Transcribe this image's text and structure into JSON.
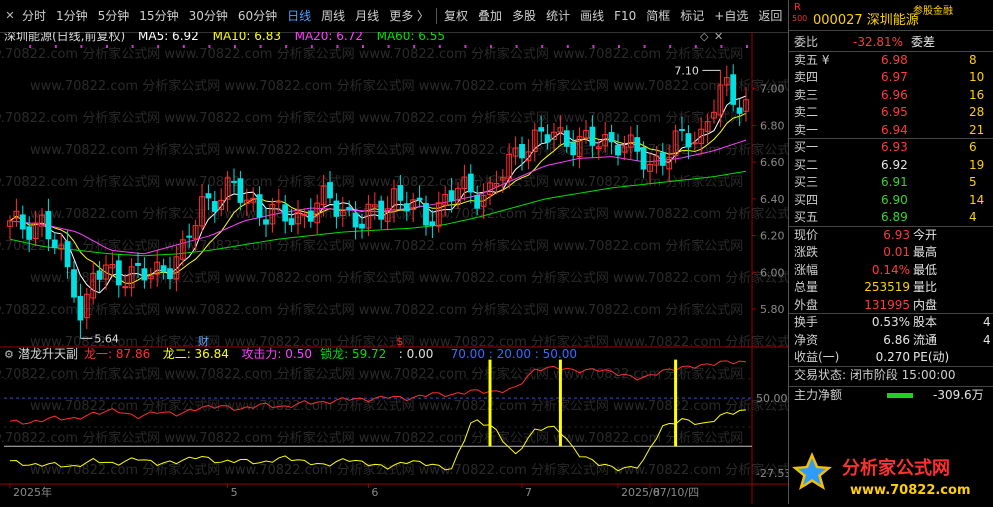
{
  "toolbar": {
    "items": [
      {
        "label": "分时"
      },
      {
        "label": "1分钟"
      },
      {
        "label": "5分钟"
      },
      {
        "label": "15分钟"
      },
      {
        "label": "30分钟"
      },
      {
        "label": "60分钟"
      },
      {
        "label": "日线"
      },
      {
        "label": "周线"
      },
      {
        "label": "月线"
      },
      {
        "label": "更多 〉"
      },
      {
        "label": "复权"
      },
      {
        "label": "叠加"
      },
      {
        "label": "多股"
      },
      {
        "label": "统计"
      },
      {
        "label": "画线"
      },
      {
        "label": "F10"
      },
      {
        "label": "简框"
      },
      {
        "label": "标记"
      },
      {
        "label": "+自选"
      },
      {
        "label": "返回"
      }
    ],
    "active": "日线"
  },
  "chart_data": [
    {
      "type": "candlestick",
      "title": "深圳能源(日线,前复权)",
      "ma_labels": [
        {
          "name": "MA5",
          "value": "MA5: 6.92",
          "color": "#ffffff"
        },
        {
          "name": "MA10",
          "value": "MA10: 6.83",
          "color": "#ffff00"
        },
        {
          "name": "MA20",
          "value": "MA20: 6.72",
          "color": "#ff40ff"
        },
        {
          "name": "MA60",
          "value": "MA60: 6.55",
          "color": "#00e000"
        }
      ],
      "y_ticks": [
        "7.00",
        "6.80",
        "6.60",
        "6.40",
        "6.20",
        "6.00",
        "5.80"
      ],
      "ylim": [
        5.62,
        7.2
      ],
      "x_ticks": [
        "2025年",
        "5",
        "6",
        "7",
        "2025/07/10/四",
        "8"
      ],
      "x_tick_days": [
        0,
        34,
        56,
        80,
        95,
        100
      ],
      "high_marker": "7.10",
      "low_marker": "5.64",
      "event_markers": [
        {
          "text": "财",
          "day": 30
        },
        {
          "text": "$",
          "day": 61
        }
      ],
      "days": 116,
      "ohlc_sampled": [
        {
          "day": 0,
          "close": 6.25
        },
        {
          "day": 5,
          "close": 6.27
        },
        {
          "day": 10,
          "close": 5.95
        },
        {
          "day": 15,
          "close": 6.0
        },
        {
          "day": 22,
          "close": 5.98
        },
        {
          "day": 27,
          "close": 6.1
        },
        {
          "day": 30,
          "close": 6.38
        },
        {
          "day": 35,
          "close": 6.45
        },
        {
          "day": 40,
          "close": 6.32
        },
        {
          "day": 45,
          "close": 6.3
        },
        {
          "day": 50,
          "close": 6.4
        },
        {
          "day": 55,
          "close": 6.26
        },
        {
          "day": 60,
          "close": 6.42
        },
        {
          "day": 65,
          "close": 6.3
        },
        {
          "day": 70,
          "close": 6.45
        },
        {
          "day": 75,
          "close": 6.43
        },
        {
          "day": 80,
          "close": 6.7
        },
        {
          "day": 85,
          "close": 6.75
        },
        {
          "day": 90,
          "close": 6.7
        },
        {
          "day": 95,
          "close": 6.72
        },
        {
          "day": 100,
          "close": 6.58
        },
        {
          "day": 104,
          "close": 6.7
        },
        {
          "day": 108,
          "close": 6.75
        },
        {
          "day": 111,
          "close": 7.02
        },
        {
          "day": 113,
          "close": 6.93
        },
        {
          "day": 115,
          "close": 6.93
        }
      ],
      "ma_sampled": {
        "MA20": [
          6.28,
          6.26,
          6.22,
          6.12,
          6.1,
          6.15,
          6.2,
          6.28,
          6.32,
          6.35,
          6.34,
          6.33,
          6.35,
          6.38,
          6.42,
          6.5,
          6.58,
          6.62,
          6.63,
          6.6,
          6.62,
          6.66,
          6.72
        ],
        "MA60": [
          6.18,
          6.14,
          6.12,
          6.1,
          6.09,
          6.1,
          6.12,
          6.15,
          6.18,
          6.2,
          6.22,
          6.23,
          6.24,
          6.26,
          6.3,
          6.35,
          6.4,
          6.43,
          6.46,
          6.48,
          6.5,
          6.52,
          6.55
        ]
      }
    },
    {
      "type": "line",
      "title": "潜龙升天副",
      "series": [
        {
          "name": "龙一",
          "value": "87.86",
          "color": "#ff3030"
        },
        {
          "name": "龙二",
          "value": "36.84",
          "color": "#ffff00"
        },
        {
          "name": "攻击力",
          "value": "0.50",
          "color": "#ff40ff"
        },
        {
          "name": "锁龙",
          "value": "59.72",
          "color": "#00e000"
        },
        {
          "name": "",
          "value": "0.00",
          "color": "#e0e0e0"
        }
      ],
      "levels_text": "70.00 : 20.00 : 50.00",
      "y_ticks": [
        "50.00",
        "-27.53"
      ],
      "ylim": [
        -35,
        100
      ],
      "signal_days": [
        75,
        86,
        104
      ],
      "long_one_sampled": [
        26,
        24,
        30,
        28,
        34,
        38,
        30,
        36,
        33,
        40,
        42,
        38,
        44,
        40,
        46,
        45,
        50,
        48,
        52,
        49,
        55,
        53,
        58,
        56,
        60,
        80,
        82,
        78,
        80,
        75,
        70,
        78,
        82,
        84,
        88,
        87
      ],
      "long_two_sampled": [
        -15,
        -20,
        -18,
        -22,
        -14,
        -19,
        -12,
        -18,
        -16,
        -10,
        -17,
        -14,
        -18,
        -11,
        -16,
        -20,
        -13,
        -18,
        -22,
        -15,
        -19,
        -24,
        28,
        20,
        -10,
        18,
        20,
        -8,
        -18,
        -24,
        -20,
        20,
        28,
        22,
        34,
        37
      ]
    }
  ],
  "quote_panel": {
    "code_name": "000027 深圳能源",
    "top_tag": "参股金融",
    "r_tag": "R",
    "r_sub": "500",
    "weibi": {
      "label": "委比",
      "value": "-32.81%",
      "label2": "委差"
    },
    "sells": [
      {
        "label": "卖五 ¥",
        "price": "6.98",
        "vol": "8"
      },
      {
        "label": "卖四",
        "price": "6.97",
        "vol": "10"
      },
      {
        "label": "卖三",
        "price": "6.96",
        "vol": "16"
      },
      {
        "label": "卖二",
        "price": "6.95",
        "vol": "28"
      },
      {
        "label": "卖一",
        "price": "6.94",
        "vol": "21"
      }
    ],
    "buys": [
      {
        "label": "买一",
        "price": "6.93",
        "vol": "6"
      },
      {
        "label": "买二",
        "price": "6.92",
        "vol": "19"
      },
      {
        "label": "买三",
        "price": "6.91",
        "vol": "5"
      },
      {
        "label": "买四",
        "price": "6.90",
        "vol": "14"
      },
      {
        "label": "买五",
        "price": "6.89",
        "vol": "4"
      }
    ],
    "stats": [
      {
        "l1": "现价",
        "v1": "6.93",
        "c1": "red",
        "l2": "今开"
      },
      {
        "l1": "涨跌",
        "v1": "0.01",
        "c1": "red",
        "l2": "最高"
      },
      {
        "l1": "涨幅",
        "v1": "0.14%",
        "c1": "red",
        "l2": "最低"
      },
      {
        "l1": "总量",
        "v1": "253519",
        "c1": "yellow",
        "l2": "量比"
      },
      {
        "l1": "外盘",
        "v1": "131995",
        "c1": "red",
        "l2": "内盘"
      }
    ],
    "stats2": [
      {
        "l1": "换手",
        "v1": "0.53%",
        "l2": "股本",
        "v2": "4"
      },
      {
        "l1": "净资",
        "v1": "6.86",
        "l2": "流通",
        "v2": "4"
      },
      {
        "l1": "收益(一)",
        "v1": "0.270",
        "l2": "PE(动)",
        "v2": ""
      }
    ],
    "trade_status": "交易状态: 闭市阶段 15:00:00",
    "main_net_label": "主力净额",
    "main_net_value": "-309.6万",
    "period_label": "日线"
  },
  "colors": {
    "up": "#ff3030",
    "down": "#00e0e0",
    "ma5": "#ffffff",
    "ma10": "#ffff00",
    "ma20": "#ff40ff",
    "ma60": "#00e000",
    "axis": "#a00000"
  },
  "logo": {
    "text": "分析家公式网",
    "url_text": "www.70822.com"
  },
  "watermark": "www.70822.com 分析家公式网"
}
